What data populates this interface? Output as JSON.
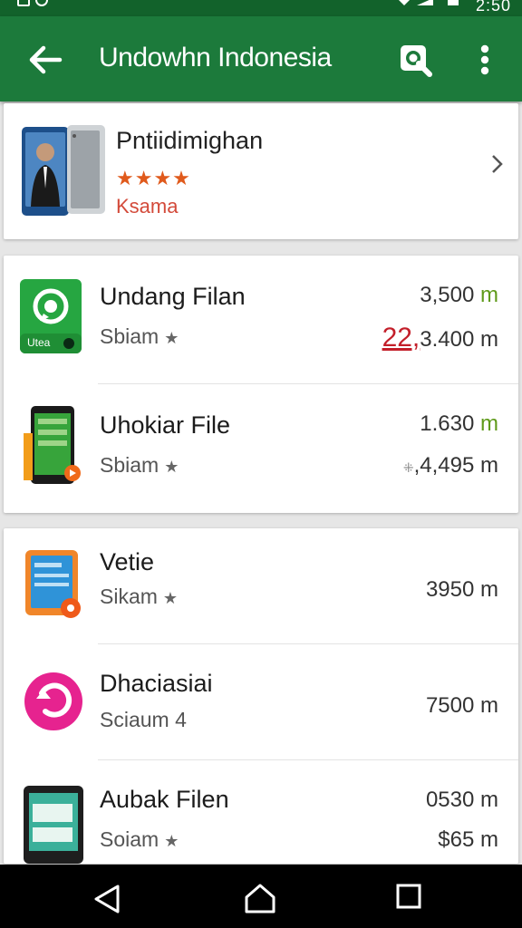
{
  "status": {
    "time": "2:50"
  },
  "appbar": {
    "title": "Undowhn Indonesia",
    "back_icon": "arrow-left-icon",
    "search_icon": "search-icon",
    "more_icon": "more-vert-icon"
  },
  "featured": {
    "name": "Pntiidimighan",
    "stars": "★★★★",
    "sub": "Ksama"
  },
  "group1": [
    {
      "name": "Undang Filan",
      "sub": "Sbiam",
      "price_num": "3,500",
      "price_unit": "m",
      "size_prefix": "22,",
      "size": "3.400 m",
      "icon": "whatsapp-icon",
      "icon_label": "Utea"
    },
    {
      "name": "Uhokiar File",
      "sub": "Sbiam",
      "price_num": "1.630",
      "price_unit": "m",
      "size_prefix": "⁜",
      "size": ",4,495 m",
      "icon": "phone-app-icon"
    }
  ],
  "group2": [
    {
      "name": "Vetie",
      "sub": "Sikam",
      "price": "3950 m",
      "icon": "tablet-app-icon"
    },
    {
      "name": "Dhaciasiai",
      "sub": "Sciaum 4",
      "price": "7500 m",
      "icon": "pink-refresh-icon"
    },
    {
      "name": "Aubak Filen",
      "sub": "Soiam",
      "price": "0530 m",
      "size": "$65 m",
      "icon": "phone-screen-icon"
    }
  ],
  "nav": {
    "back": "nav-back-icon",
    "home": "nav-home-icon",
    "recents": "nav-recents-icon"
  },
  "colors": {
    "appbar": "#1c7a3b",
    "statusbar": "#12622b",
    "accent_red": "#c31f2a",
    "accent_green": "#5f9a1a"
  }
}
